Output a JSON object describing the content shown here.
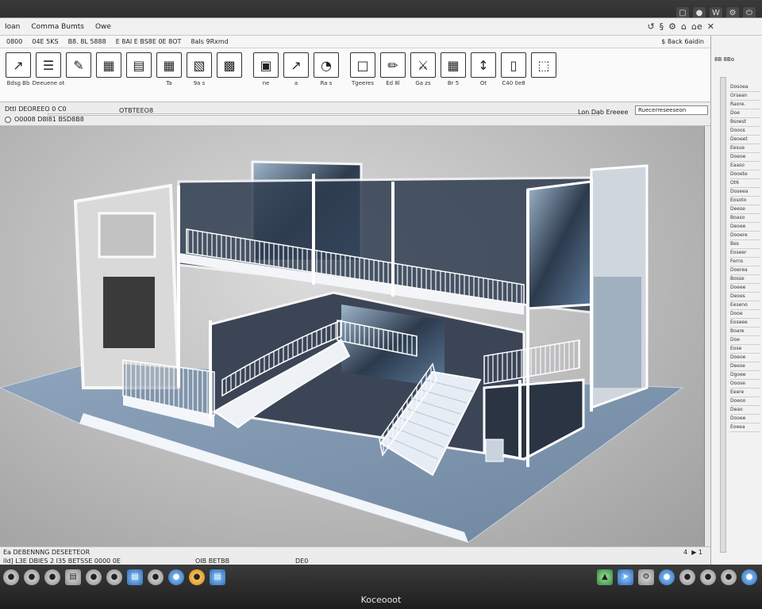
{
  "menubar": {
    "items": [
      "Ioan",
      "Comma Bumts",
      "Owe"
    ],
    "win_icons": [
      "↺",
      "§",
      "⚙",
      "⌂",
      "⌂e",
      "✕"
    ]
  },
  "ribbon_tabs": {
    "items": [
      "0800",
      "04E 5KS",
      "B8. 8L 5888",
      "E 8AI E BS8E 0E 8OT",
      "8aIs 9Rxmd"
    ],
    "right": "$ 8ack 6aidin"
  },
  "ribbon": {
    "tools": [
      {
        "icon": "↗",
        "label": "Bdsg Bb"
      },
      {
        "icon": "☰",
        "label": "Deeuene ot"
      },
      {
        "icon": "✎",
        "label": ""
      },
      {
        "icon": "▦",
        "label": ""
      },
      {
        "icon": "▤",
        "label": ""
      },
      {
        "icon": "▦",
        "label": "Ta"
      },
      {
        "icon": "▧",
        "label": "9a s"
      },
      {
        "icon": "▩",
        "label": ""
      },
      {
        "icon": "▣",
        "label": "ne"
      },
      {
        "icon": "↗",
        "label": "a"
      },
      {
        "icon": "◔",
        "label": "Ra s"
      },
      {
        "icon": "□",
        "label": "Tgeeres"
      },
      {
        "icon": "✏",
        "label": "Ed 8l"
      },
      {
        "icon": "⚔",
        "label": "Ga zs"
      },
      {
        "icon": "▦",
        "label": "Br 5"
      },
      {
        "icon": "↕",
        "label": "Ot"
      },
      {
        "icon": "▯",
        "label": "C40 0e8"
      },
      {
        "icon": "⬚",
        "label": ""
      }
    ]
  },
  "options": {
    "line1": "Dttl DEOREEO 0   C0",
    "line2": "O0008 D8I81 BSD8B8",
    "mid": "OTBTEEO8",
    "right_label": "Lon Dab Ereeee",
    "right_input": "Ruecerreseeseon"
  },
  "props": {
    "header": "8B 8Bo",
    "header2": "",
    "rows": [
      "Dosoea",
      "Orsean",
      "Raore.",
      "Doe",
      "Bsoest",
      "Dooos",
      "Deoeet",
      "Eesue",
      "Doeoe",
      "Eaaso",
      "Dooete",
      "Ot6",
      "Doseea",
      "Eosoto",
      "Deese",
      "Boaso",
      "Deoee",
      "Dooere",
      "Bes",
      "Eoseer",
      "Ferns",
      "Doerea",
      "Bosse",
      "Doeee",
      "Deoes",
      "Eeseno",
      "Dooe",
      "Eoseee",
      "Boare",
      "Doe",
      "Eose",
      "Doeoe",
      "Deese",
      "Dgoee",
      "Ooose",
      "Eeere",
      "Doeoo",
      "Deao",
      "Dooee",
      "Eoeea"
    ]
  },
  "status": {
    "line1": "Ea DEBENNNG DESEETEOR",
    "line2": "lld] L3E DBIES 2 I35 BETSSE 0000 0E",
    "line3": "OIB BETBB",
    "line4": "DE0",
    "right": "4  ▶ 1"
  },
  "taskbar": {
    "label": "Koceooot"
  }
}
